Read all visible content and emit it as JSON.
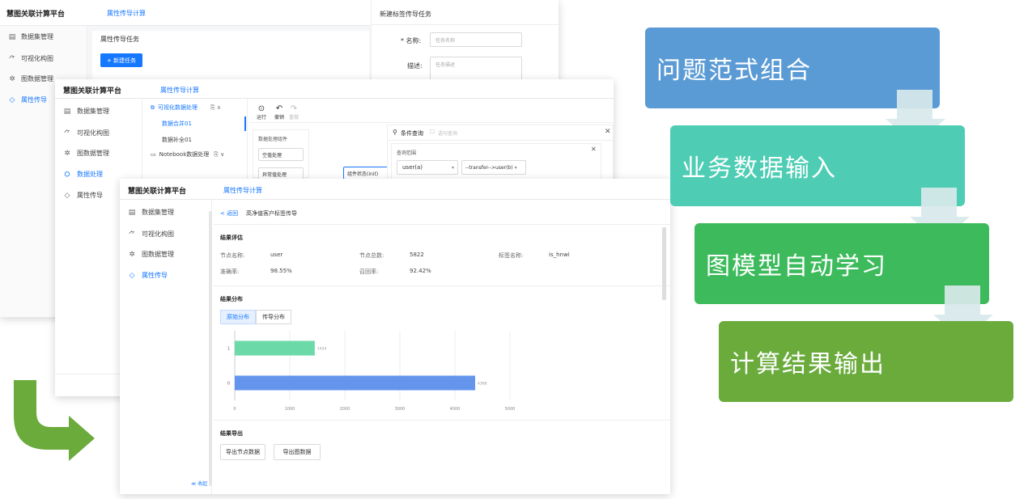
{
  "win1": {
    "brand": "慧图关联计算平台",
    "tab": "属性传导计算",
    "nav": [
      {
        "label": "数据集管理",
        "icon": "▤"
      },
      {
        "label": "可视化构图",
        "icon": "⺈"
      },
      {
        "label": "图数据管理",
        "icon": "✲"
      },
      {
        "label": "属性传导",
        "icon": "◇"
      }
    ],
    "section_title": "属性传导任务",
    "new_task_button": "+ 新建任务",
    "form": {
      "title": "新建标签传导任务",
      "name_label": "* 名称:",
      "name_placeholder": "任务名称",
      "desc_label": "描述:",
      "desc_placeholder": "任务描述"
    }
  },
  "win2": {
    "brand": "慧图关联计算平台",
    "tab": "属性传导计算",
    "nav": [
      {
        "label": "数据集管理",
        "icon": "▤"
      },
      {
        "label": "可视化构图",
        "icon": "⺈"
      },
      {
        "label": "图数据管理",
        "icon": "✲"
      },
      {
        "label": "数据处理",
        "icon": "⛭"
      },
      {
        "label": "属性传导",
        "icon": "◇"
      }
    ],
    "tree": {
      "group1": "可视化数据处理",
      "item1": "数据合并01",
      "item2": "数据补全01",
      "group2": "Notebook数据处理"
    },
    "toolbar": {
      "run": "运行",
      "undo": "撤销",
      "redo": "重做"
    },
    "components": {
      "title": "数据处理组件",
      "c1": "空值处理",
      "c2": "异常值处理"
    },
    "node_label": "组件状态(init)",
    "query": {
      "title": "条件查询",
      "option": "语句查询",
      "range_label": "查询范围",
      "select1": "user(a)",
      "select2": "--transfer-->user(b)"
    }
  },
  "win3": {
    "brand": "慧图关联计算平台",
    "tab": "属性传导计算",
    "nav": [
      {
        "label": "数据集管理",
        "icon": "▤"
      },
      {
        "label": "可视化构图",
        "icon": "⺈"
      },
      {
        "label": "图数据管理",
        "icon": "✲"
      },
      {
        "label": "属性传导",
        "icon": "◇"
      }
    ],
    "collapse": "≪ 收起",
    "back": "< 返回",
    "breadcrumb": "高净值客户标签传导",
    "eval_title": "结果评估",
    "metrics": [
      {
        "label": "节点名称:",
        "value": "user"
      },
      {
        "label": "节点总数:",
        "value": "5822"
      },
      {
        "label": "标签名称:",
        "value": "is_hnwi"
      },
      {
        "label": "准确率:",
        "value": "98.55%"
      },
      {
        "label": "召回率:",
        "value": "92.42%"
      }
    ],
    "dist_title": "结果分布",
    "dist_tabs": [
      "原始分布",
      "传导分布"
    ],
    "export_title": "结果导出",
    "export_buttons": [
      "导出节点数据",
      "导出图数据"
    ]
  },
  "chart_data": {
    "type": "bar",
    "orientation": "horizontal",
    "categories": [
      "1",
      "0"
    ],
    "values": [
      1454,
      4368
    ],
    "colors": [
      "#6cd9a8",
      "#6495ed"
    ],
    "xlim": [
      0,
      5000
    ],
    "xticks": [
      "0",
      "1000",
      "2000",
      "3000",
      "4000",
      "5000"
    ],
    "value_labels": [
      "1454",
      "4368"
    ]
  },
  "flow": {
    "steps": [
      {
        "label": "问题范式组合",
        "color": "#5b9bd5"
      },
      {
        "label": "业务数据输入",
        "color": "#4ecdb4"
      },
      {
        "label": "图模型自动学习",
        "color": "#3dbb5c"
      },
      {
        "label": "计算结果输出",
        "color": "#6aab3c"
      }
    ],
    "connector_color": "#d8e8ea",
    "arrow_color": "#6aab3c"
  }
}
